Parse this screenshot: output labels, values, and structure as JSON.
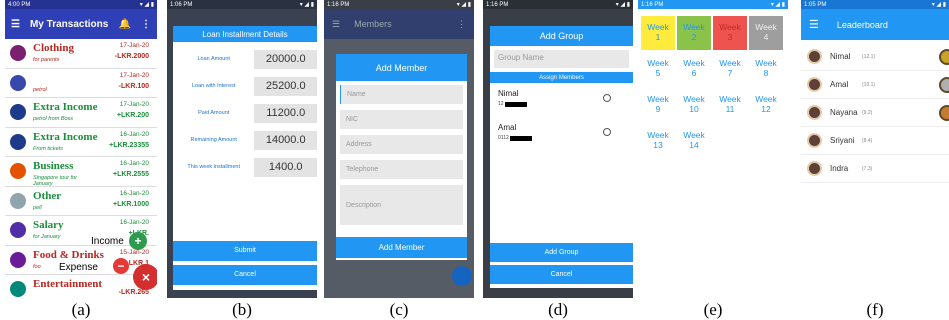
{
  "captions": [
    "(a)",
    "(b)",
    "(c)",
    "(d)",
    "(e)",
    "(f)"
  ],
  "a": {
    "status": "4:00 PM",
    "title": "My Transactions",
    "items": [
      {
        "name": "Clothing",
        "sub": "for parents",
        "date": "17-Jan-20",
        "amount": "-LKR.2000",
        "type": "exp",
        "color": "#7b1f6f"
      },
      {
        "name": "",
        "sub": "petrol",
        "date": "17-Jan-20",
        "amount": "-LKR.100",
        "type": "exp",
        "color": "#3949ab"
      },
      {
        "name": "Extra Income",
        "sub": "petrol from Boss",
        "date": "17-Jan-20",
        "amount": "+LKR.200",
        "type": "inc",
        "color": "#1e3a8a"
      },
      {
        "name": "Extra Income",
        "sub": "From tickets",
        "date": "16-Jan-20",
        "amount": "+LKR.23355",
        "type": "inc",
        "color": "#1e3a8a"
      },
      {
        "name": "Business",
        "sub": "Singapore tour for January",
        "date": "16-Jan-20",
        "amount": "+LKR.2555",
        "type": "inc",
        "color": "#e65100"
      },
      {
        "name": "Other",
        "sub": "pell",
        "date": "16-Jan-20",
        "amount": "+LKR.1000",
        "type": "inc",
        "color": "#90a4ae"
      },
      {
        "name": "Salary",
        "sub": "for January",
        "date": "16-Jan-20",
        "amount": "+LKR.",
        "type": "inc",
        "color": "#512da8"
      },
      {
        "name": "Food & Drinks",
        "sub": "foo",
        "date": "15-Jan-20",
        "amount": "-LKR.1",
        "type": "exp",
        "color": "#6a1b9a"
      },
      {
        "name": "Entertainment",
        "sub": "",
        "date": "",
        "amount": "-LKR.265",
        "type": "exp",
        "color": "#00897b"
      }
    ],
    "income_label": "Income",
    "expense_label": "Expense",
    "plus": "+",
    "minus": "−",
    "close": "×"
  },
  "b": {
    "title": "Loan Installment Details",
    "rows": [
      {
        "label": "Loan Amount",
        "value": "20000.0"
      },
      {
        "label": "Loan with Interest",
        "value": "25200.0"
      },
      {
        "label": "Paid Amount",
        "value": "11200.0"
      },
      {
        "label": "Remaining Amount",
        "value": "14000.0"
      },
      {
        "label": "This week installment",
        "value": "1400.0"
      }
    ],
    "submit": "Submit",
    "cancel": "Cancel"
  },
  "c": {
    "app_title": "Members",
    "title": "Add Member",
    "fields": [
      "Name",
      "NIC",
      "Address",
      "Telephone",
      "Description"
    ],
    "button": "Add Member"
  },
  "d": {
    "title": "Add Group",
    "group_placeholder": "Group Name",
    "assign": "Assign Members",
    "members": [
      {
        "name": "Nimal",
        "phone": "12"
      },
      {
        "name": "Amal",
        "phone": "0112"
      }
    ],
    "add_group": "Add Group",
    "cancel": "Cancel"
  },
  "e": {
    "weeks": [
      {
        "label": "Week",
        "num": "1",
        "bg": "#ffeb3b"
      },
      {
        "label": "Week",
        "num": "2",
        "bg": "#8bc34a"
      },
      {
        "label": "Week",
        "num": "3",
        "bg": "#ef5350"
      },
      {
        "label": "Week",
        "num": "4",
        "bg": "#9e9e9e"
      },
      {
        "label": "Week",
        "num": "5",
        "bg": ""
      },
      {
        "label": "Week",
        "num": "6",
        "bg": ""
      },
      {
        "label": "Week",
        "num": "7",
        "bg": ""
      },
      {
        "label": "Week",
        "num": "8",
        "bg": ""
      },
      {
        "label": "Week",
        "num": "9",
        "bg": ""
      },
      {
        "label": "Week",
        "num": "10",
        "bg": ""
      },
      {
        "label": "Week",
        "num": "11",
        "bg": ""
      },
      {
        "label": "Week",
        "num": "12",
        "bg": ""
      },
      {
        "label": "Week",
        "num": "13",
        "bg": ""
      },
      {
        "label": "Week",
        "num": "14",
        "bg": ""
      }
    ]
  },
  "f": {
    "title": "Leaderboard",
    "rows": [
      {
        "name": "Nimal",
        "score": "(12.1)",
        "medal": "#c9a227"
      },
      {
        "name": "Amal",
        "score": "(10.1)",
        "medal": "#b0b0b0"
      },
      {
        "name": "Nayana",
        "score": "(9.2)",
        "medal": "#c77b30"
      },
      {
        "name": "Sriyani",
        "score": "(8.4)",
        "medal": ""
      },
      {
        "name": "Indra",
        "score": "(7.3)",
        "medal": ""
      }
    ]
  }
}
